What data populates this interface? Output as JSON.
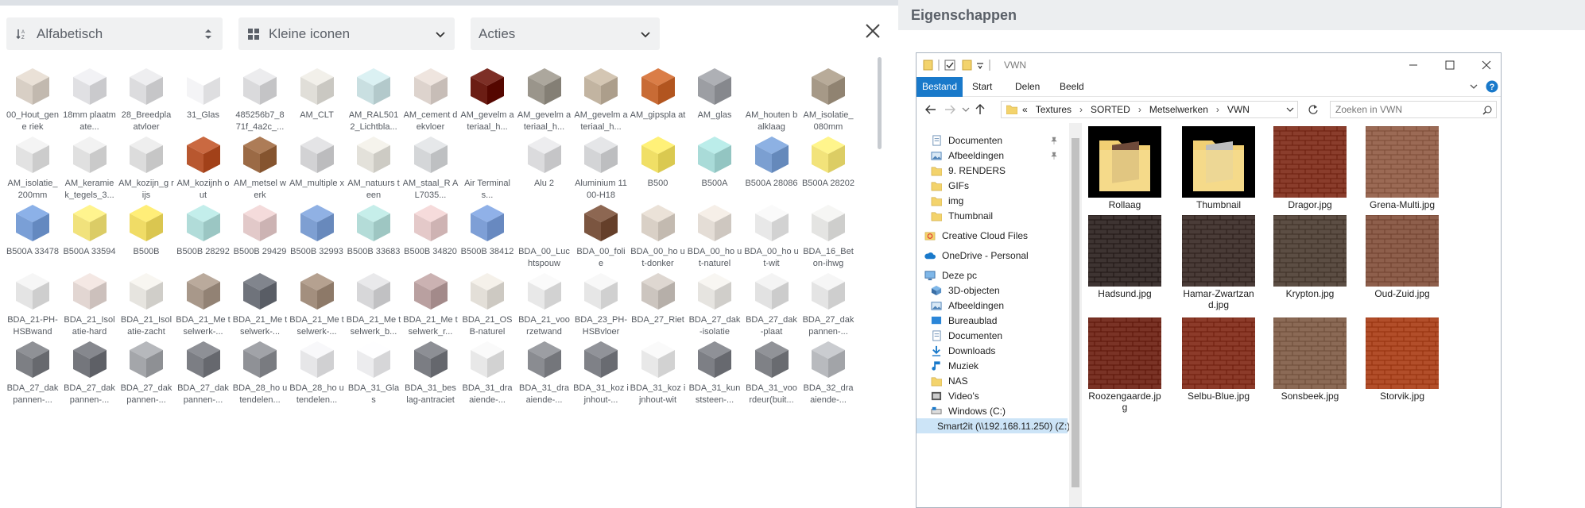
{
  "toolbar": {
    "sort_label": "Alfabetisch",
    "view_label": "Kleine iconen",
    "actions_label": "Acties"
  },
  "materials": [
    {
      "name": "00_Hout_gene riek",
      "color": "#d8cfc5"
    },
    {
      "name": "18mm plaatmate...",
      "color": "#e0e0e3"
    },
    {
      "name": "28_Breedpla atvloer",
      "color": "#dcdcde"
    },
    {
      "name": "31_Glas",
      "color": "#f4f4f6"
    },
    {
      "name": "485256b7_8 71f_4a2c_...",
      "color": "#dadadc"
    },
    {
      "name": "AM_CLT",
      "color": "#e0ded8"
    },
    {
      "name": "AM_RAL501 2_Lichtbla...",
      "color": "#c9dfe1"
    },
    {
      "name": "AM_cement dekvloer",
      "color": "#ddd3cd"
    },
    {
      "name": "AM_gevelm ateriaal_h...",
      "color": "#6b1d14"
    },
    {
      "name": "AM_gevelm ateriaal_h...",
      "color": "#9a958b"
    },
    {
      "name": "AM_gevelm ateriaal_h...",
      "color": "#c2b4a1"
    },
    {
      "name": "AM_gipspla at",
      "color": "#c86b35"
    },
    {
      "name": "AM_glas",
      "color": "#9c9ea3"
    },
    {
      "name": "AM_houten balklaag",
      "color": "#ffffff"
    },
    {
      "name": "AM_isolatie_ 080mm",
      "color": "#a69987"
    },
    {
      "name": "AM_isolatie_ 200mm",
      "color": "#e2e2e2"
    },
    {
      "name": "AM_keramie k_tegels_3...",
      "color": "#e0e0e0"
    },
    {
      "name": "AM_kozijn_g rijs",
      "color": "#dcdcdc"
    },
    {
      "name": "AM_kozijnh out",
      "color": "#b8572f"
    },
    {
      "name": "AM_metsel werk",
      "color": "#9b6a45"
    },
    {
      "name": "AM_multiple x",
      "color": "#d2d2d4"
    },
    {
      "name": "AM_natuurs teen",
      "color": "#e3e1da"
    },
    {
      "name": "AM_staal_R AL7035...",
      "color": "#d4d6d8"
    },
    {
      "name": "Air Terminals...",
      "color": "#ffffff"
    },
    {
      "name": "Alu 2",
      "color": "#dbdbdd"
    },
    {
      "name": "Aluminium 1100-H18",
      "color": "#d3d4d6"
    },
    {
      "name": "B500",
      "color": "#f0df66"
    },
    {
      "name": "B500A",
      "color": "#a9dbd8"
    },
    {
      "name": "B500A 28086",
      "color": "#7b9fd1"
    },
    {
      "name": "B500A 28202",
      "color": "#f2e37a"
    },
    {
      "name": "B500A 33478",
      "color": "#7a9fd6"
    },
    {
      "name": "B500A 33594",
      "color": "#f1e27c"
    },
    {
      "name": "B500B",
      "color": "#f0dc66"
    },
    {
      "name": "B500B 28292",
      "color": "#b1dcd9"
    },
    {
      "name": "B500B 29429",
      "color": "#e2c9c9"
    },
    {
      "name": "B500B 32993",
      "color": "#7e9fd2"
    },
    {
      "name": "B500B 33683",
      "color": "#b4dcd8"
    },
    {
      "name": "B500B 34820",
      "color": "#e4c9c9"
    },
    {
      "name": "B500B 38412",
      "color": "#7e9fd6"
    },
    {
      "name": "BDA_00_Luc htspouw",
      "color": "#ffffff"
    },
    {
      "name": "BDA_00_foli e",
      "color": "#7b5540"
    },
    {
      "name": "BDA_00_ho ut-donker",
      "color": "#d9d0c6"
    },
    {
      "name": "BDA_00_ho ut-naturel",
      "color": "#e4ddd6"
    },
    {
      "name": "BDA_00_ho ut-wit",
      "color": "#e8e8e8"
    },
    {
      "name": "BDA_16_Bet on-ihwg",
      "color": "#e4e4e2"
    },
    {
      "name": "BDA_21-PH- HSBwand",
      "color": "#e4e4e4"
    },
    {
      "name": "BDA_21_Isol atie-hard",
      "color": "#e2d6d2"
    },
    {
      "name": "BDA_21_Isol atie-zacht",
      "color": "#e6e4df"
    },
    {
      "name": "BDA_21_Me tselwerk-...",
      "color": "#a8988a"
    },
    {
      "name": "BDA_21_Me tselwerk-...",
      "color": "#6f737b"
    },
    {
      "name": "BDA_21_Me tselwerk-...",
      "color": "#a38f7e"
    },
    {
      "name": "BDA_21_Me tselwerk_b...",
      "color": "#d7d7d9"
    },
    {
      "name": "BDA_21_Me tselwerk_r...",
      "color": "#b9a0a0"
    },
    {
      "name": "BDA_21_OS B-naturel",
      "color": "#e3dfd8"
    },
    {
      "name": "BDA_21_voo rzetwand",
      "color": "#e8e8e8"
    },
    {
      "name": "BDA_23_PH- HSBvloer",
      "color": "#e6e6e6"
    },
    {
      "name": "BDA_27_Riet",
      "color": "#ccc5bf"
    },
    {
      "name": "BDA_27_dak -isolatie",
      "color": "#e6e4e0"
    },
    {
      "name": "BDA_27_dak -plaat",
      "color": "#e2e2e2"
    },
    {
      "name": "BDA_27_dak pannen-...",
      "color": "#e4e4e4"
    },
    {
      "name": "BDA_27_dak pannen-...",
      "color": "#7d7f84"
    },
    {
      "name": "BDA_27_dak pannen-...",
      "color": "#74767c"
    },
    {
      "name": "BDA_27_dak pannen-...",
      "color": "#a4a6aa"
    },
    {
      "name": "BDA_27_dak pannen-...",
      "color": "#7c7e84"
    },
    {
      "name": "BDA_28_ho utendelen...",
      "color": "#8f9196"
    },
    {
      "name": "BDA_28_ho utendelen...",
      "color": "#e6e6e8"
    },
    {
      "name": "BDA_31_Gla s",
      "color": "#ececee"
    },
    {
      "name": "BDA_31_bes lag-antraciet",
      "color": "#7b7d83"
    },
    {
      "name": "BDA_31_dra aiende-...",
      "color": "#e8e8e8"
    },
    {
      "name": "BDA_31_dra aiende-...",
      "color": "#8a8c91"
    },
    {
      "name": "BDA_31_koz ijnhout-...",
      "color": "#7f8187"
    },
    {
      "name": "BDA_31_koz ijnhout-wit",
      "color": "#e8e8e8"
    },
    {
      "name": "BDA_31_kun ststeen-...",
      "color": "#7d7f85"
    },
    {
      "name": "BDA_31_voo rdeur(buit...",
      "color": "#7f8186"
    },
    {
      "name": "BDA_32_dra aiende-...",
      "color": "#b8babe"
    }
  ],
  "properties": {
    "title": "Eigenschappen"
  },
  "explorer": {
    "title": "VWN",
    "ribbon_tabs": [
      "Bestand",
      "Start",
      "Delen",
      "Beeld"
    ],
    "address": [
      "«",
      "Textures",
      "SORTED",
      "Metselwerken",
      "VWN"
    ],
    "search_placeholder": "Zoeken in VWN",
    "nav_items": [
      {
        "label": "Documenten",
        "icon": "documents-icon",
        "pinned": true
      },
      {
        "label": "Afbeeldingen",
        "icon": "pictures-icon",
        "pinned": true
      },
      {
        "label": "9. RENDERS",
        "icon": "folder-icon",
        "pinned": false
      },
      {
        "label": "GIFs",
        "icon": "folder-icon",
        "pinned": false
      },
      {
        "label": "img",
        "icon": "folder-icon",
        "pinned": false
      },
      {
        "label": "Thumbnail",
        "icon": "folder-icon",
        "pinned": false
      },
      {
        "label": "Creative Cloud Files",
        "icon": "creative-cloud-icon",
        "pinned": false
      },
      {
        "label": "OneDrive - Personal",
        "icon": "onedrive-icon",
        "pinned": false
      },
      {
        "label": "Deze pc",
        "icon": "computer-icon",
        "pinned": false
      },
      {
        "label": "3D-objecten",
        "icon": "3d-objects-icon",
        "pinned": false
      },
      {
        "label": "Afbeeldingen",
        "icon": "pictures-icon",
        "pinned": false
      },
      {
        "label": "Bureaublad",
        "icon": "desktop-icon",
        "pinned": false
      },
      {
        "label": "Documenten",
        "icon": "documents-icon",
        "pinned": false
      },
      {
        "label": "Downloads",
        "icon": "downloads-icon",
        "pinned": false
      },
      {
        "label": "Muziek",
        "icon": "music-icon",
        "pinned": false
      },
      {
        "label": "NAS",
        "icon": "folder-icon",
        "pinned": false
      },
      {
        "label": "Video's",
        "icon": "videos-icon",
        "pinned": false
      },
      {
        "label": "Windows (C:)",
        "icon": "drive-icon",
        "pinned": false
      },
      {
        "label": "Smart2it (\\\\192.168.11.250) (Z:)",
        "icon": "network-drive-icon",
        "pinned": false
      }
    ],
    "files": [
      {
        "name": "Rollaag",
        "type": "folder",
        "color": "#6e4a3a"
      },
      {
        "name": "Thumbnail",
        "type": "folder",
        "color": "#bdbdbd"
      },
      {
        "name": "Dragor.jpg",
        "type": "image",
        "color": "#8a3d2c"
      },
      {
        "name": "Grena-Multi.jpg",
        "type": "image",
        "color": "#9b6a55"
      },
      {
        "name": "Hadsund.jpg",
        "type": "image",
        "color": "#3e3432"
      },
      {
        "name": "Hamar-Zwartzand.jpg",
        "type": "image",
        "color": "#4a3c38"
      },
      {
        "name": "Krypton.jpg",
        "type": "image",
        "color": "#5c4e44"
      },
      {
        "name": "Oud-Zuid.jpg",
        "type": "image",
        "color": "#8e5f4c"
      },
      {
        "name": "Roozengaarde.jpg",
        "type": "image",
        "color": "#7a3326"
      },
      {
        "name": "Selbu-Blue.jpg",
        "type": "image",
        "color": "#8c3b2a"
      },
      {
        "name": "Sonsbeek.jpg",
        "type": "image",
        "color": "#8b6a56"
      },
      {
        "name": "Storvik.jpg",
        "type": "image",
        "color": "#b24e2a"
      }
    ]
  }
}
